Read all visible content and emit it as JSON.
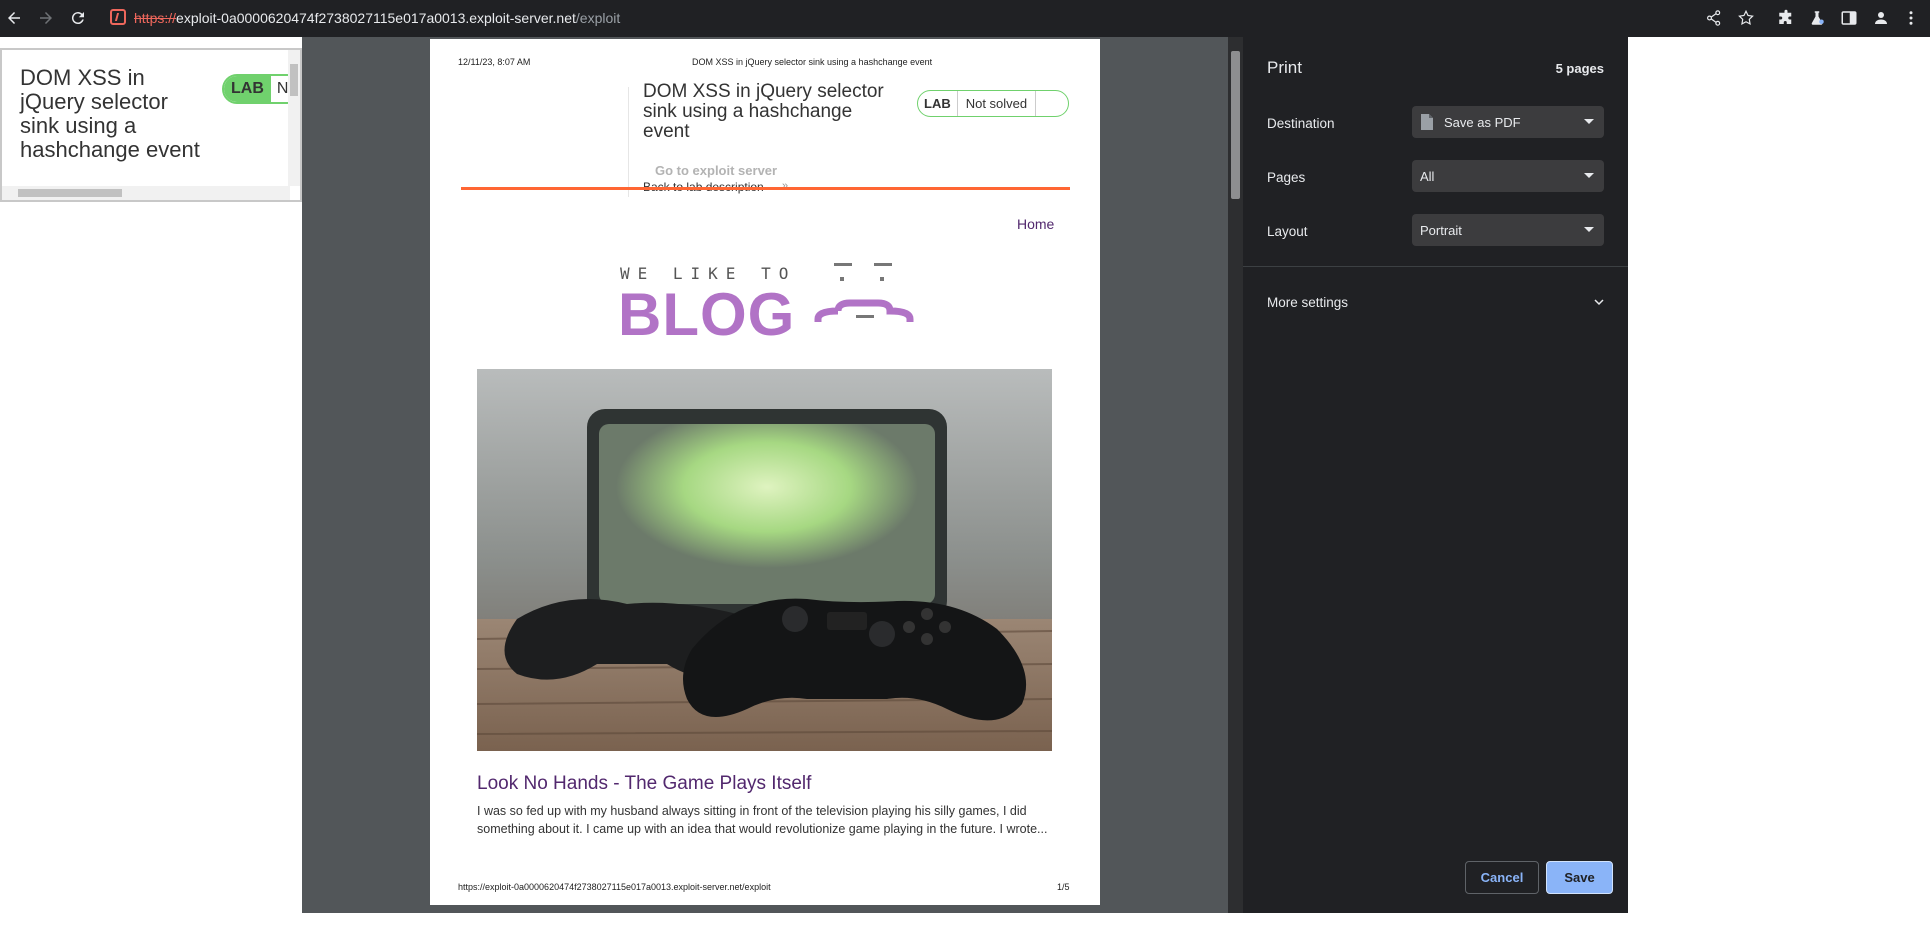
{
  "browser": {
    "url_scheme": "https://",
    "url_host": "exploit-0a0000620474f2738027115e017a0013.exploit-server.net",
    "url_path": "/exploit"
  },
  "background_page": {
    "lab_title": "DOM XSS in jQuery selector sink using a hashchange event",
    "lab_badge": "LAB",
    "lab_status_partial": "N"
  },
  "print_preview": {
    "header_date": "12/11/23, 8:07 AM",
    "header_title": "DOM XSS in jQuery selector sink using a hashchange event",
    "lab_title": "DOM XSS in jQuery selector sink using a hashchange event",
    "lab_badge": "LAB",
    "lab_status": "Not solved",
    "go_exploit": "Go to exploit server",
    "back_to_lab": "Back to lab description",
    "back_arrow": "»",
    "home_link": "Home",
    "blog_small": "WE LIKE TO",
    "blog_big": "BLOG",
    "post_title": "Look No Hands - The Game Plays Itself",
    "post_body": "I was so fed up with my husband always sitting in front of the television playing his silly games, I did something about it. I came up with an idea that would revolutionize game playing in the future. I wrote...",
    "footer_url": "https://exploit-0a0000620474f2738027115e017a0013.exploit-server.net/exploit",
    "footer_page": "1/5"
  },
  "print_settings": {
    "title": "Print",
    "page_count": "5 pages",
    "destination_label": "Destination",
    "destination_value": "Save as PDF",
    "pages_label": "Pages",
    "pages_value": "All",
    "layout_label": "Layout",
    "layout_value": "Portrait",
    "more_settings": "More settings",
    "cancel": "Cancel",
    "save": "Save"
  },
  "colors": {
    "accent_blue": "#8ab4f8",
    "lab_green": "#70d16d",
    "orange_rule": "#ff6633",
    "blog_purple": "#b173c6",
    "link_purple": "#52286e"
  }
}
